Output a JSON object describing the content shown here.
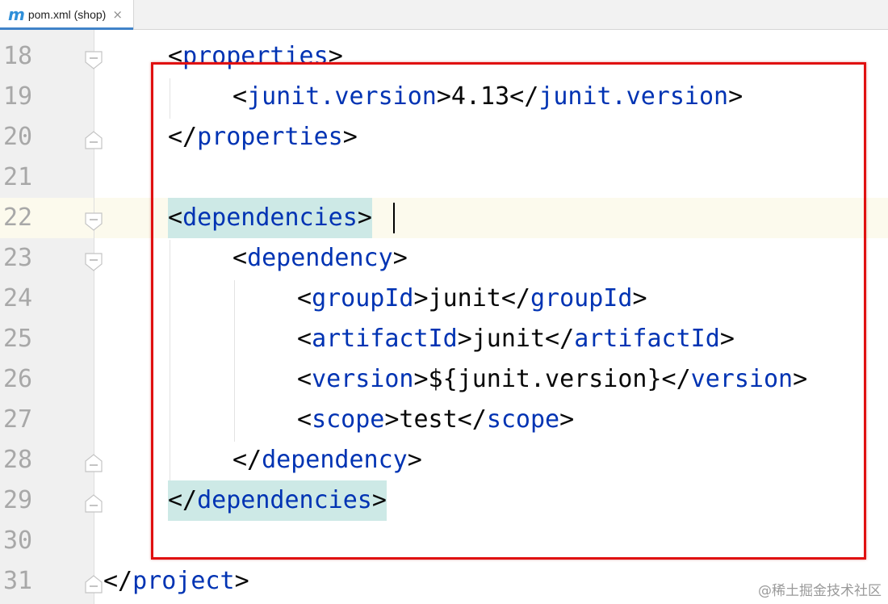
{
  "tab": {
    "icon": "m",
    "label": "pom.xml (shop)",
    "close": "×"
  },
  "lines": [
    {
      "num": "18",
      "fold": "open"
    },
    {
      "num": "19",
      "fold": "none"
    },
    {
      "num": "20",
      "fold": "close"
    },
    {
      "num": "21",
      "fold": "none"
    },
    {
      "num": "22",
      "fold": "open"
    },
    {
      "num": "23",
      "fold": "open"
    },
    {
      "num": "24",
      "fold": "none"
    },
    {
      "num": "25",
      "fold": "none"
    },
    {
      "num": "26",
      "fold": "none"
    },
    {
      "num": "27",
      "fold": "none"
    },
    {
      "num": "28",
      "fold": "close"
    },
    {
      "num": "29",
      "fold": "close"
    },
    {
      "num": "30",
      "fold": "none"
    },
    {
      "num": "31",
      "fold": "close"
    }
  ],
  "code": {
    "l18": {
      "open": "<",
      "tag": "properties",
      "close": ">"
    },
    "l19": {
      "open": "<",
      "tag": "junit.version",
      "mid": ">4.13</",
      "tag2": "junit.version",
      "close": ">"
    },
    "l20": {
      "open": "</",
      "tag": "properties",
      "close": ">"
    },
    "l22": {
      "open": "<",
      "tag": "dependencies",
      "close": ">"
    },
    "l23": {
      "open": "<",
      "tag": "dependency",
      "close": ">"
    },
    "l24": {
      "open": "<",
      "tag": "groupId",
      "mid": ">junit</",
      "tag2": "groupId",
      "close": ">"
    },
    "l25": {
      "open": "<",
      "tag": "artifactId",
      "mid": ">junit</",
      "tag2": "artifactId",
      "close": ">"
    },
    "l26": {
      "open": "<",
      "tag": "version",
      "mid": ">${junit.version}</",
      "tag2": "version",
      "close": ">"
    },
    "l27": {
      "open": "<",
      "tag": "scope",
      "mid": ">test</",
      "tag2": "scope",
      "close": ">"
    },
    "l28": {
      "open": "</",
      "tag": "dependency",
      "close": ">"
    },
    "l29": {
      "open": "</",
      "tag": "dependencies",
      "close": ">"
    },
    "l31": {
      "open": "</",
      "tag": "project",
      "close": ">"
    }
  },
  "current_line": "22",
  "watermark": "@稀土掘金技术社区",
  "colors": {
    "tag": "#0033b3",
    "text": "#080808",
    "highlight_box": "#e01010",
    "matched_tag_bg": "#cde9e6",
    "current_line_bg": "#fcfaed"
  }
}
